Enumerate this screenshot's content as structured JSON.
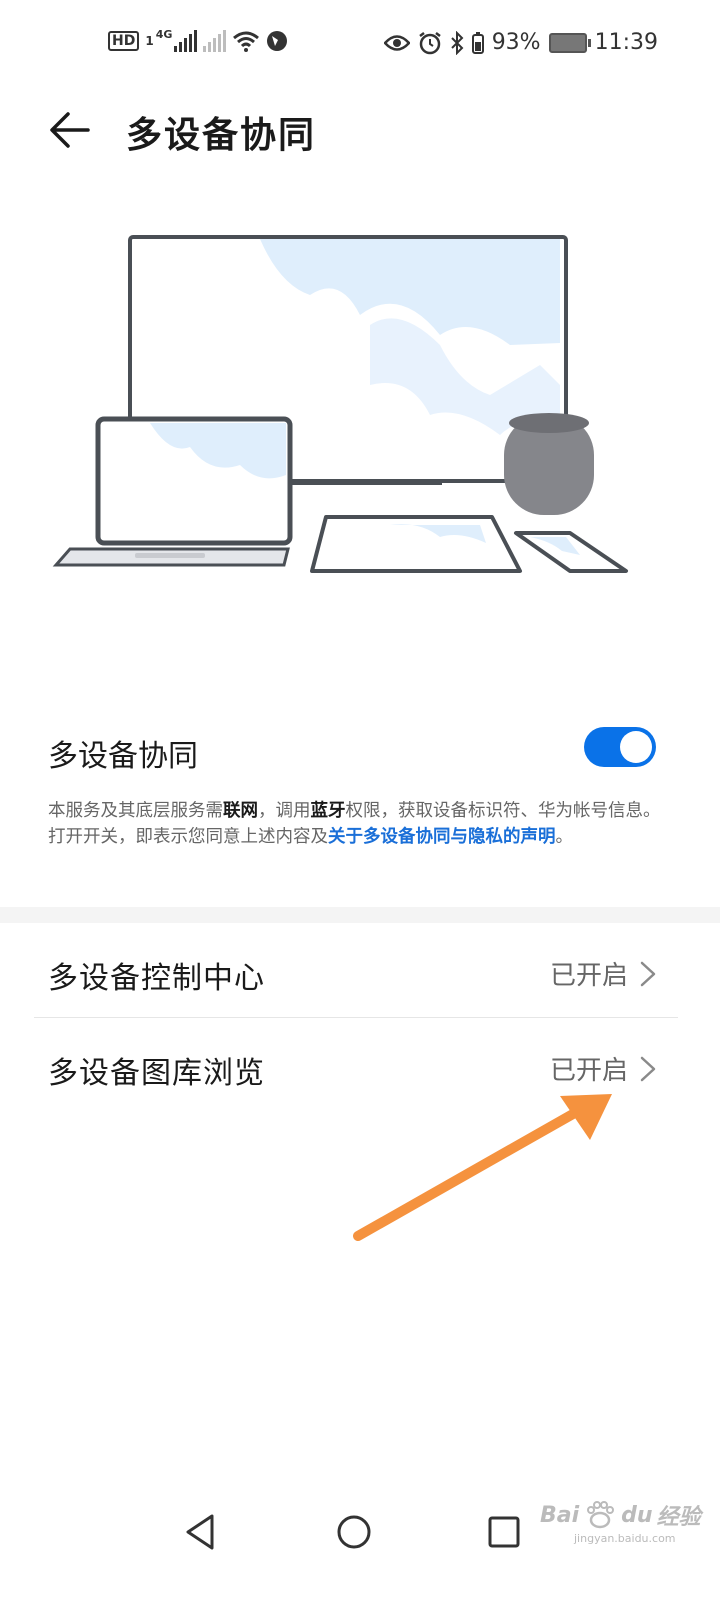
{
  "status_bar": {
    "hd_badge": "HD",
    "sim_slot": "1",
    "network_label": "4G",
    "battery_percent": "93%",
    "time": "11:39",
    "icons": [
      "hd-icon",
      "signal-icon",
      "signal-empty-icon",
      "wifi-icon",
      "vpn-globe-icon",
      "eye-icon",
      "alarm-icon",
      "bluetooth-icon",
      "battery-icon"
    ]
  },
  "header": {
    "title": "多设备协同",
    "back_icon": "arrow-left-icon"
  },
  "illustration": {
    "name": "multi-device-illustration",
    "accent": "#dfeefc",
    "frame": "#4a4f55",
    "speaker": "#85868b"
  },
  "main_toggle": {
    "label": "多设备协同",
    "state": "on",
    "color": "#0a72e8"
  },
  "description": {
    "p1": "本服务及其底层服务需",
    "b1": "联网",
    "p2": "，调用",
    "b2": "蓝牙",
    "p3": "权限，获取设备标识符、华为帐号信息。打开开关，即表示您同意上述内容及",
    "link": "关于多设备协同与隐私的声明",
    "p4": "。"
  },
  "settings_items": [
    {
      "label": "多设备控制中心",
      "value": "已开启"
    },
    {
      "label": "多设备图库浏览",
      "value": "已开启"
    }
  ],
  "annotation": {
    "arrow_color": "#f5923e"
  },
  "nav_bar": {
    "icons": [
      "back-triangle-icon",
      "home-circle-icon",
      "recents-square-icon"
    ]
  },
  "watermark": {
    "text_a": "Bai",
    "text_b": "du",
    "text_c": "经验",
    "url": "jingyan.baidu.com"
  }
}
